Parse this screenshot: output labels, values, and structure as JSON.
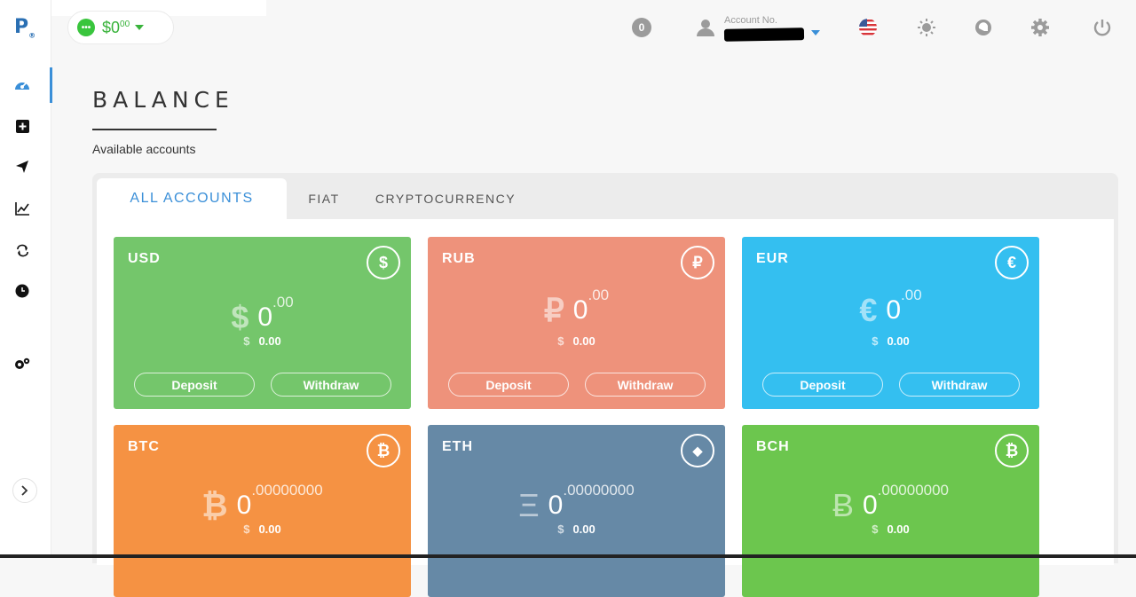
{
  "logo": {
    "text": "P",
    "mark": "®"
  },
  "wallet": {
    "symbol": "$",
    "amount": "0",
    "decimals": "00",
    "dot": "•••"
  },
  "header": {
    "notification_count": "0",
    "account_label": "Account No."
  },
  "page": {
    "title": "BALANCE",
    "subtitle": "Available accounts"
  },
  "tabs": [
    {
      "label": "ALL ACCOUNTS"
    },
    {
      "label": "FIAT"
    },
    {
      "label": "CRYPTOCURRENCY"
    }
  ],
  "cards": [
    {
      "code": "USD",
      "icon": "$",
      "symbol": "$",
      "value": "0",
      "decimals": ".00",
      "usd_symbol": "$",
      "usd_value": "0.00",
      "deposit": "Deposit",
      "withdraw": "Withdraw",
      "color": "#74c66b"
    },
    {
      "code": "RUB",
      "icon": "₽",
      "symbol": "₽",
      "value": "0",
      "decimals": ".00",
      "usd_symbol": "$",
      "usd_value": "0.00",
      "deposit": "Deposit",
      "withdraw": "Withdraw",
      "color": "#ee927b"
    },
    {
      "code": "EUR",
      "icon": "€",
      "symbol": "€",
      "value": "0",
      "decimals": ".00",
      "usd_symbol": "$",
      "usd_value": "0.00",
      "deposit": "Deposit",
      "withdraw": "Withdraw",
      "color": "#34bff0"
    },
    {
      "code": "BTC",
      "icon": "₿",
      "symbol": "₿",
      "value": "0",
      "decimals": ".00000000",
      "usd_symbol": "$",
      "usd_value": "0.00",
      "color": "#f59243"
    },
    {
      "code": "ETH",
      "icon": "◆",
      "symbol": "Ξ",
      "value": "0",
      "decimals": ".00000000",
      "usd_symbol": "$",
      "usd_value": "0.00",
      "color": "#6689a6"
    },
    {
      "code": "BCH",
      "icon": "₿",
      "symbol": "Ƀ",
      "value": "0",
      "decimals": ".00000000",
      "usd_symbol": "$",
      "usd_value": "0.00",
      "color": "#6cc64e"
    }
  ],
  "icons": {
    "sidebar": [
      "dashboard-icon",
      "add-box-icon",
      "send-icon",
      "chart-icon",
      "exchange-icon",
      "clock-icon",
      "settings-gears-icon",
      "chevron-right-icon"
    ],
    "topbar": [
      "user-icon",
      "flag-us-icon",
      "sun-icon",
      "chat-icon",
      "gear-icon",
      "power-icon"
    ]
  },
  "colors": {
    "accent": "#3a8fd8",
    "wallet_green": "#39b33b"
  }
}
